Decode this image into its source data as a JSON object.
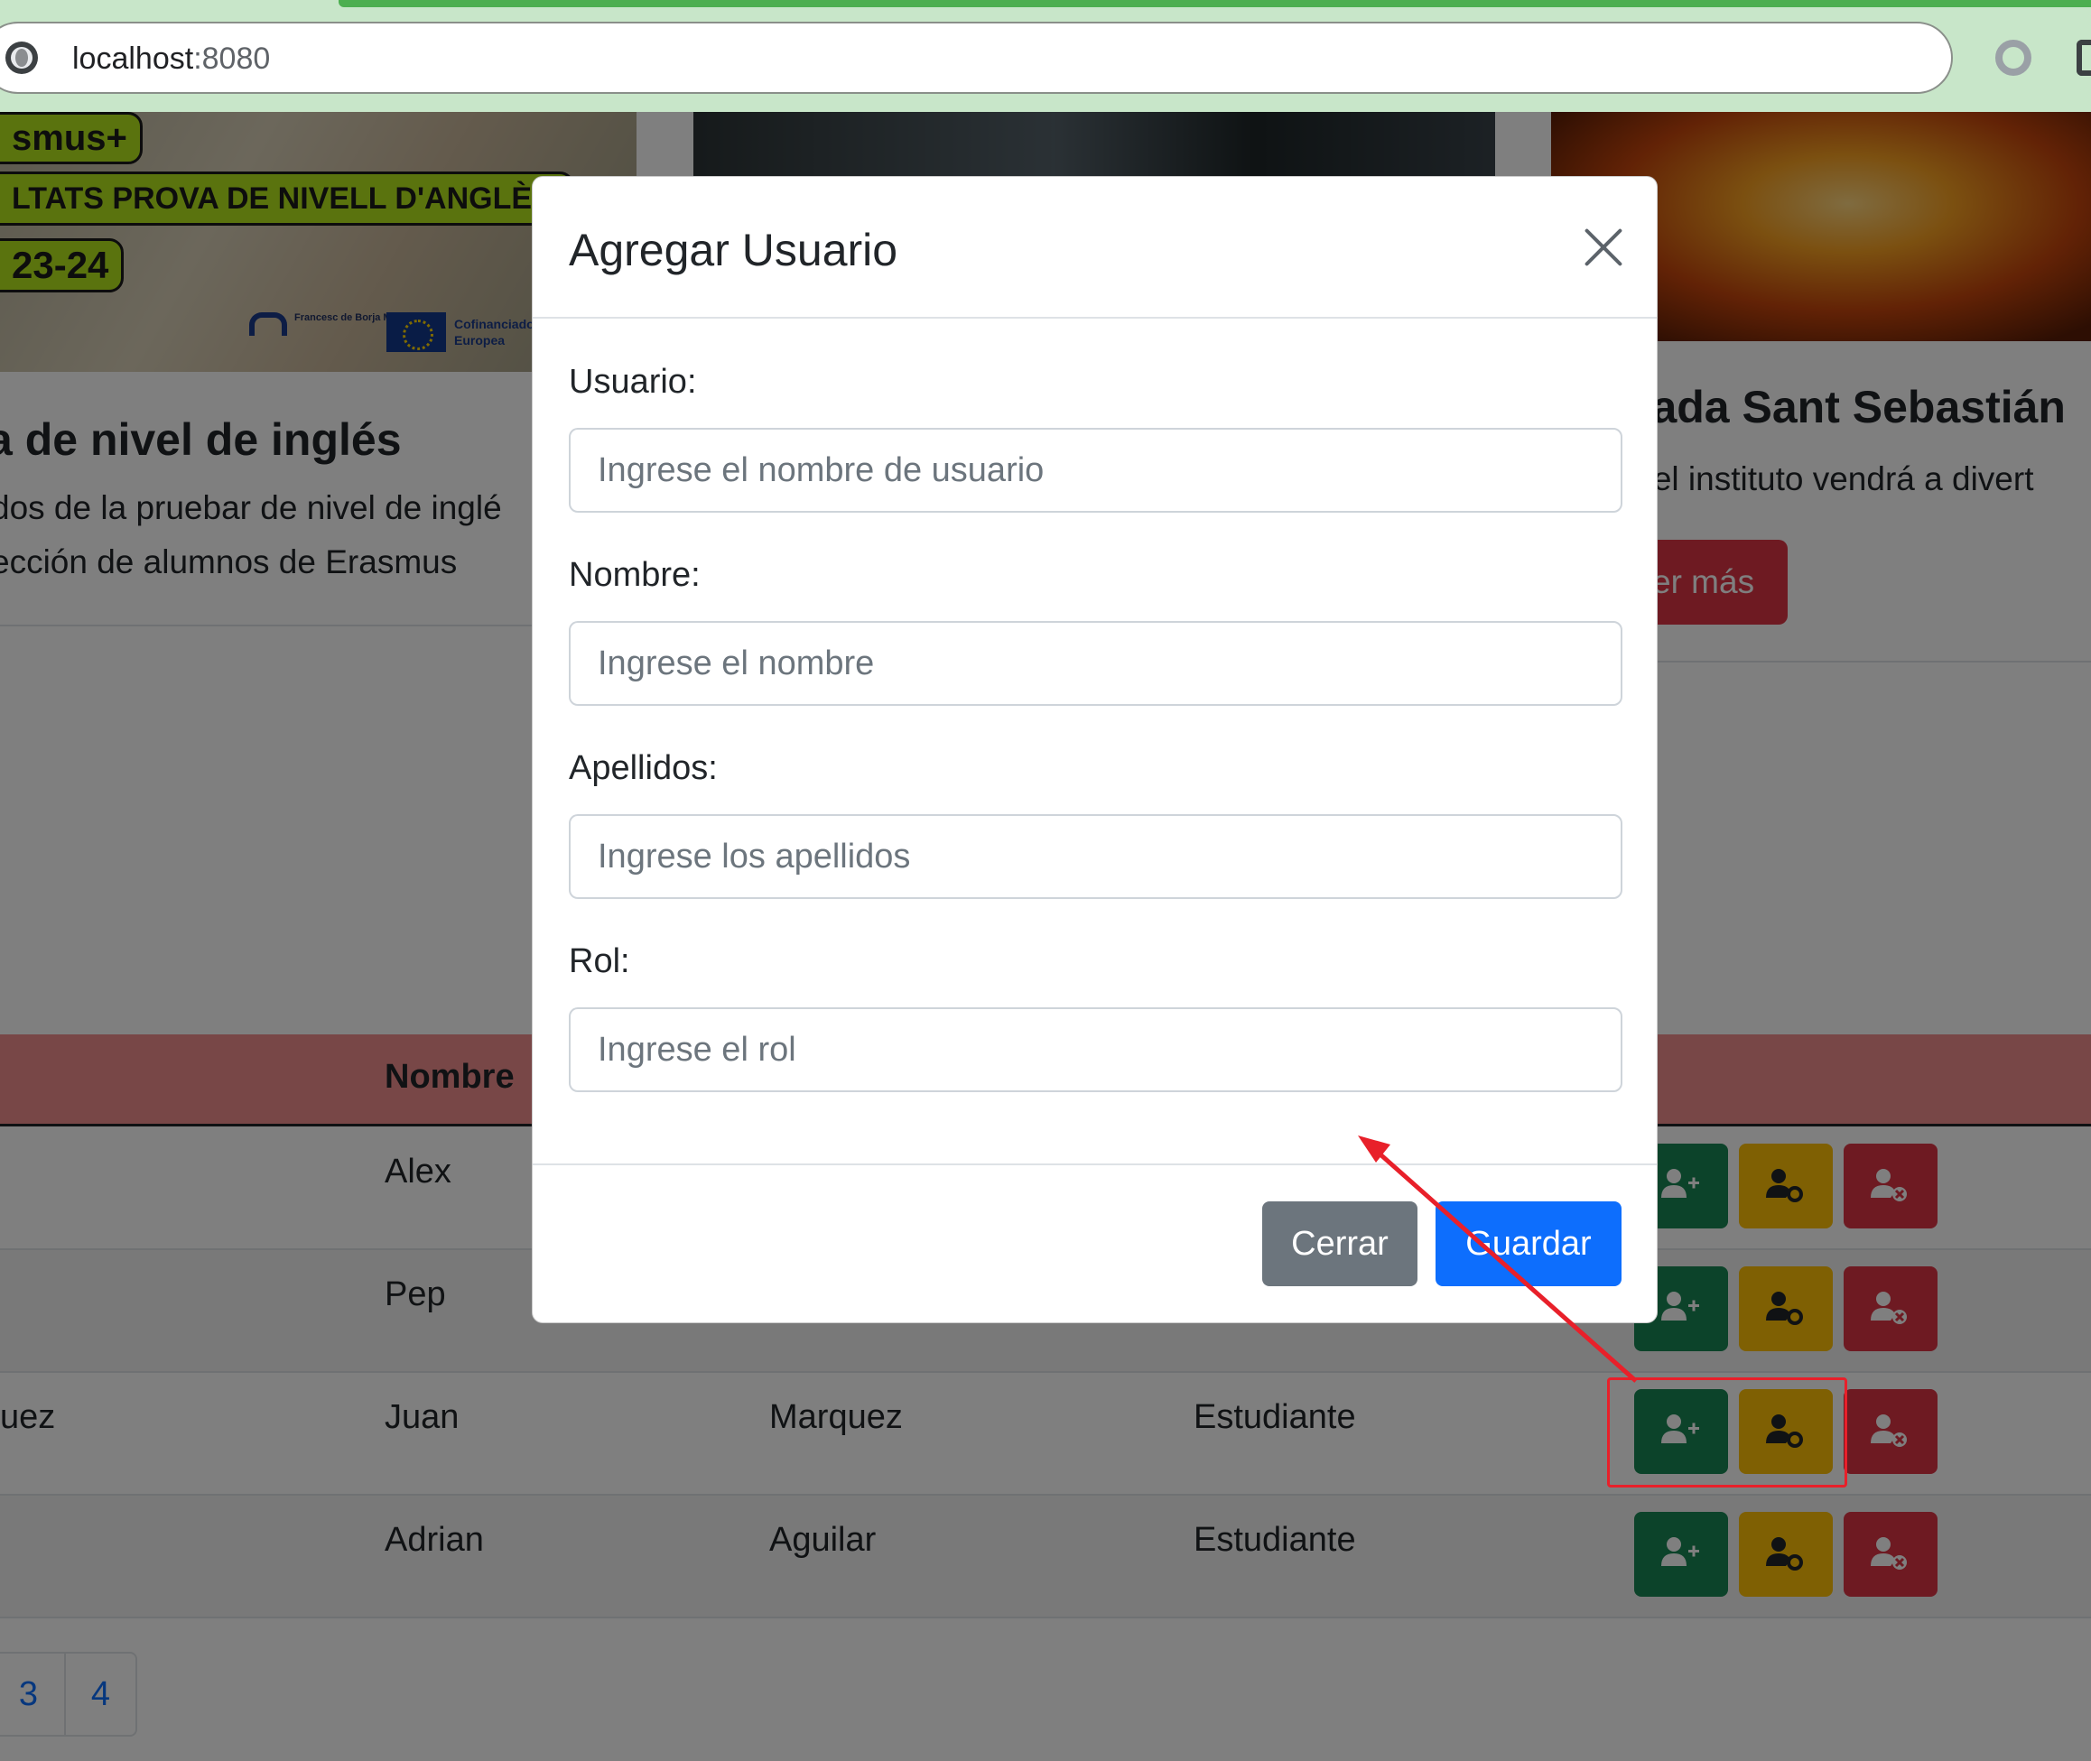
{
  "browser": {
    "url_host": "localhost",
    "url_port": ":8080"
  },
  "background_page": {
    "card1": {
      "badges": [
        "smus+",
        "LTATS PROVA DE NIVELL D'ANGLÈS",
        "23-24"
      ],
      "logo_text": "Francesc de Borja Moll",
      "eu_text": "Cofinanciado por la Unión Europea",
      "title": "a de nivel de inglés",
      "text_line1": "dos de la pruebar de nivel de inglé",
      "text_line2": "ección de alumnos de Erasmus"
    },
    "card3": {
      "title": "rada Sant Sebastián",
      "text": "o el instituto vendrá a divert",
      "button": "er más"
    },
    "table": {
      "header_nombre": "Nombre",
      "rows": [
        {
          "col1": "",
          "nombre": "Alex",
          "apellidos": "",
          "rol": ""
        },
        {
          "col1": "",
          "nombre": "Pep",
          "apellidos": "",
          "rol": ""
        },
        {
          "col1": "uez",
          "nombre": "Juan",
          "apellidos": "Marquez",
          "rol": "Estudiante"
        },
        {
          "col1": "",
          "nombre": "Adrian",
          "apellidos": "Aguilar",
          "rol": "Estudiante"
        }
      ],
      "action_icons": [
        "user-plus-icon",
        "user-gear-icon",
        "user-remove-icon"
      ],
      "action_colors": {
        "add": "#198754",
        "edit": "#ffc107",
        "delete": "#dc3545"
      }
    },
    "pagination": [
      "3",
      "4"
    ]
  },
  "modal": {
    "title": "Agregar Usuario",
    "fields": [
      {
        "label": "Usuario:",
        "placeholder": "Ingrese el nombre de usuario"
      },
      {
        "label": "Nombre:",
        "placeholder": "Ingrese el nombre"
      },
      {
        "label": "Apellidos:",
        "placeholder": "Ingrese los apellidos"
      },
      {
        "label": "Rol:",
        "placeholder": "Ingrese el rol"
      }
    ],
    "close_label": "Cerrar",
    "save_label": "Guardar",
    "colors": {
      "primary": "#0d6efd",
      "secondary": "#6c757d"
    }
  },
  "annotation": {
    "color": "#e8202a"
  }
}
